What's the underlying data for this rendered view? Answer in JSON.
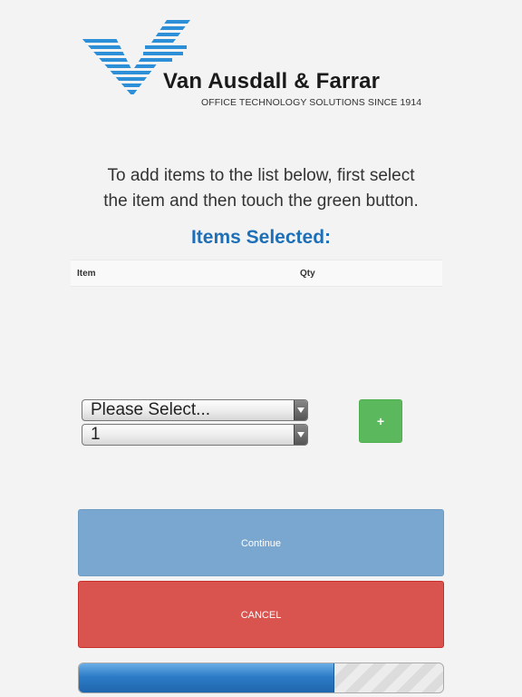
{
  "brand": {
    "name": "Van Ausdall & Farrar",
    "tagline": "OFFICE TECHNOLOGY SOLUTIONS SINCE 1914",
    "color": "#2d8fd8"
  },
  "instructions": {
    "line1": "To add items to the list below, first select",
    "line2": "the item and then touch the green button."
  },
  "items_heading": "Items Selected:",
  "table": {
    "columns": [
      "Item",
      "Qty"
    ]
  },
  "form": {
    "item_select": {
      "value": "Please Select..."
    },
    "qty_select": {
      "value": "1"
    },
    "add_label": "+"
  },
  "buttons": {
    "continue_label": "Continue",
    "cancel_label": "CANCEL"
  },
  "progress": {
    "fraction": 0.7
  },
  "colors": {
    "heading": "#1d6fb8",
    "add": "#5cb85c",
    "continue": "#7aa7cf",
    "cancel": "#d9534f"
  }
}
